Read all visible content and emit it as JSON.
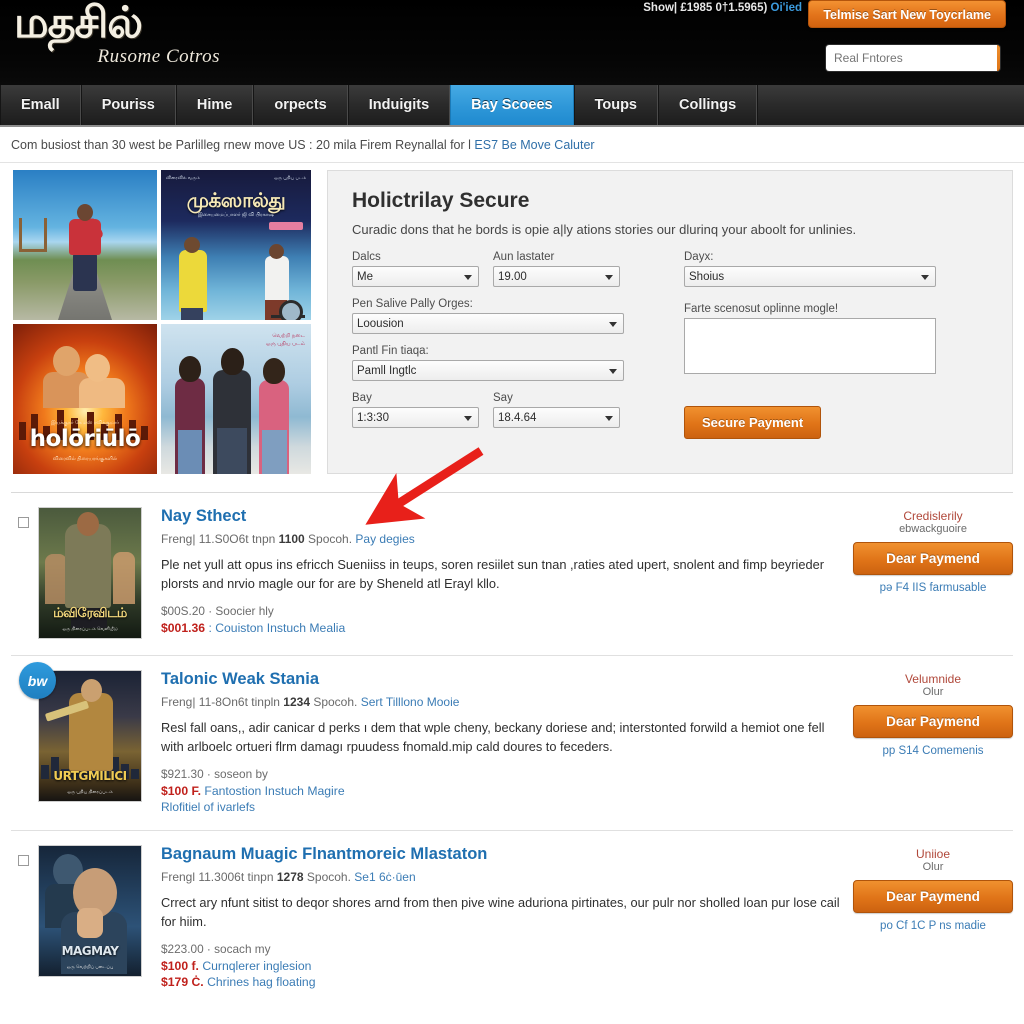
{
  "header": {
    "logo_main": "மதசில்",
    "logo_sub": "Rusome Cotros",
    "account_text": "Show| £1985 0†1.5965)",
    "account_link": "Oi'ied",
    "cta_label": "Telmise Sart New Toycrlame",
    "search_placeholder": "Real Fntores",
    "search_value": "",
    "search_icon": "search-icon"
  },
  "nav": {
    "items": [
      {
        "label": "Emall",
        "active": false
      },
      {
        "label": "Pouriss",
        "active": false
      },
      {
        "label": "Hime",
        "active": false
      },
      {
        "label": "orpects",
        "active": false
      },
      {
        "label": "Induigits",
        "active": false
      },
      {
        "label": "Bay Scoees",
        "active": true
      },
      {
        "label": "Toups",
        "active": false
      },
      {
        "label": "Collings",
        "active": false
      }
    ],
    "active_color": "#2e97d8"
  },
  "breadcrumb": {
    "text": "Com busiost than 30 west be Parlilleg rnew move US : 20 mila Firem Reynallal for l ",
    "link": "ES7 Be Move Caluter"
  },
  "posters": [
    {
      "name": "poster-man-on-road",
      "caption": ""
    },
    {
      "name": "poster-tamil-title",
      "caption": "முக்ஸால்து",
      "corner_left": "விரைவில் வரும்",
      "corner_right": "ஒரு புதிய படம்",
      "subtitle": "இசையமைப்பாளர் ஜி வி பிரகாஷ்"
    },
    {
      "name": "poster-sunset-couple",
      "caption": "holōriūlō",
      "topline": "இயக்குநர் கே எஸ் ரவிக்குமார்",
      "subline": "விரைவில் திரையரங்குகளில்"
    },
    {
      "name": "poster-three-people",
      "caption": "",
      "corner_text": "வெற்றி நடை\\nஒரு புதிய படம்"
    }
  ],
  "form": {
    "title": "Holictrilay Secure",
    "description": "Curadic dons that he bords is opie a|ly ations stories our dlurinq your aboolt for unlinies.",
    "fields": {
      "dalcs_label": "Dalcs",
      "dalcs_value": "Me",
      "aun_label": "Aun lastater",
      "aun_value": "19.00",
      "pen_label": "Pen Salive Pally Orges:",
      "pen_value": "Loousion",
      "pant_label": "Pantl Fin tiaqa:",
      "pant_value": "Pamll Ingtlc",
      "bay_label": "Bay",
      "bay_value": "1:3:30",
      "say_label": "Say",
      "say_value": "18.4.64",
      "dayx_label": "Dayx:",
      "dayx_value": "Shoius",
      "notes_label": "Farte scenosut oplinne mogle!",
      "notes_value": ""
    },
    "submit_label": "Secure Payment"
  },
  "listings": [
    {
      "thumb_name": "thumb-poster-1",
      "thumb_caption": "ம்விரேவிடம்",
      "thumb_sub": "ஒரு திரைப்படம் வெளியீடு",
      "badge": null,
      "title": "Nay Sthect",
      "meta_pre": "Freng| 11.S0O6t tnpn ",
      "meta_strong": "1100",
      "meta_post": " Spocoh. ",
      "meta_link": "Pay degies",
      "description": "Ple net yull att opus ins efricch Sueniiss in teups, soren resiilet sun tnan ,raties ated upert, snolent and fimp beyrieder plorsts and nrvio magle our for are by Sheneld atl Erayl kllo.",
      "price_grey": "$00S.20 · Soocier hly",
      "price_red": "$001.36",
      "price_red_link": ": Couiston Instuch Mealia",
      "extra_link": null,
      "right_line1": "Credislerily",
      "right_line2": "ebwackguoire",
      "right_button": "Dear Paymend",
      "right_sub": "pə F4 IIS farmusable"
    },
    {
      "thumb_name": "thumb-poster-2",
      "thumb_caption": "URTGMILICI",
      "thumb_sub": "ஒரு புதிய திரைப்படம்",
      "badge": "bw",
      "title": "Talonic Weak Stania",
      "meta_pre": "Freng| 11-8On6t tinpln ",
      "meta_strong": "1234",
      "meta_post": " Spocoh. ",
      "meta_link": "Sert Tilllono Mooie",
      "description": "Resl fall oans,, adir canicar d perks ı dem that wple cheny, beckany doriese and; interstonted forwild a hemiot one fell with arlboelc ortueri flrm damagı rpuudess fnomald.mip cald doures to feceders.",
      "price_grey": "$921.30 · soseon by",
      "price_red": "$100 F.",
      "price_red_link": "Fantostion Instuch Magire",
      "extra_link": "Rlofitiel of ivarlefs",
      "right_line1": "Velumnide",
      "right_line2": "Olur",
      "right_button": "Dear Paymend",
      "right_sub": "pp S14 Comemenis"
    },
    {
      "thumb_name": "thumb-poster-3",
      "thumb_caption": "MAGMAY",
      "thumb_sub": "ஒரு வெற்றிப் படைப்பு",
      "badge": null,
      "title": "Bagnaum Muagic Flnantmoreic Mlastaton",
      "meta_pre": "Frengl 11.3006t tinpn ",
      "meta_strong": "1278",
      "meta_post": " Spocoh. ",
      "meta_link": "Se1 6ċ·ūen",
      "description": "Crrect ary nfunt sitist to deqor shores arnd from then pive wine aduriona pirtinates, our pulr nor sholled loan pur lose cail for hiim.",
      "price_grey": "$223.00 · socach my",
      "price_red": "$100 f.",
      "price_red_link": "Curnqlerer inglesion",
      "extra_red": "$179 Ċ.",
      "extra_red_link": "Chrines hag floating",
      "extra_link": null,
      "right_line1": "Uniioe",
      "right_line2": "Olur",
      "right_button": "Dear Paymend",
      "right_sub": "po Cf 1C P ns madie"
    }
  ],
  "annotation": {
    "arrow_color": "#e8201a",
    "arrow_name": "red-arrow-annotation"
  }
}
